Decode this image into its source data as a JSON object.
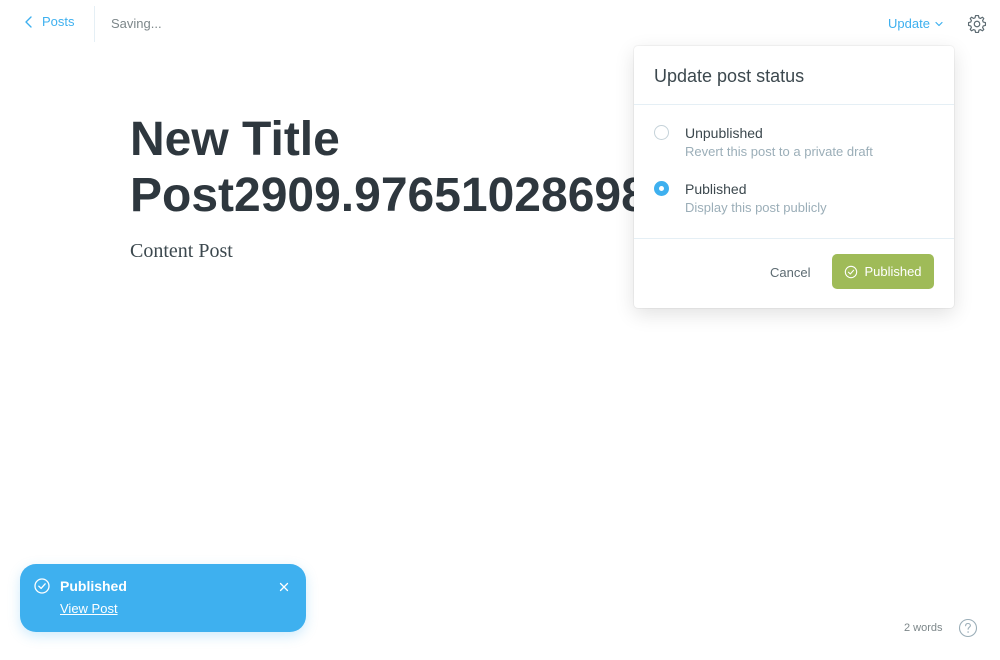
{
  "topbar": {
    "back_label": "Posts",
    "status_text": "Saving...",
    "update_label": "Update"
  },
  "editor": {
    "title": "New Title Post2909.976510286987",
    "body": "Content Post"
  },
  "popover": {
    "heading": "Update post status",
    "options": [
      {
        "label": "Unpublished",
        "description": "Revert this post to a private draft",
        "selected": false
      },
      {
        "label": "Published",
        "description": "Display this post publicly",
        "selected": true
      }
    ],
    "cancel_label": "Cancel",
    "confirm_label": "Published"
  },
  "toast": {
    "title": "Published",
    "link_label": "View Post"
  },
  "footer": {
    "word_count": "2 words"
  },
  "icons": {
    "back": "chevron-left-icon",
    "update_caret": "chevron-down-icon",
    "settings": "gear-icon",
    "confirm": "check-circle-icon",
    "toast": "check-circle-icon",
    "toast_close": "close-icon",
    "help": "question-circle-icon"
  },
  "colors": {
    "accent": "#3eb0ef",
    "publish_button": "#9fbb58",
    "title_text": "#2e373e",
    "muted": "#9baeb8"
  }
}
